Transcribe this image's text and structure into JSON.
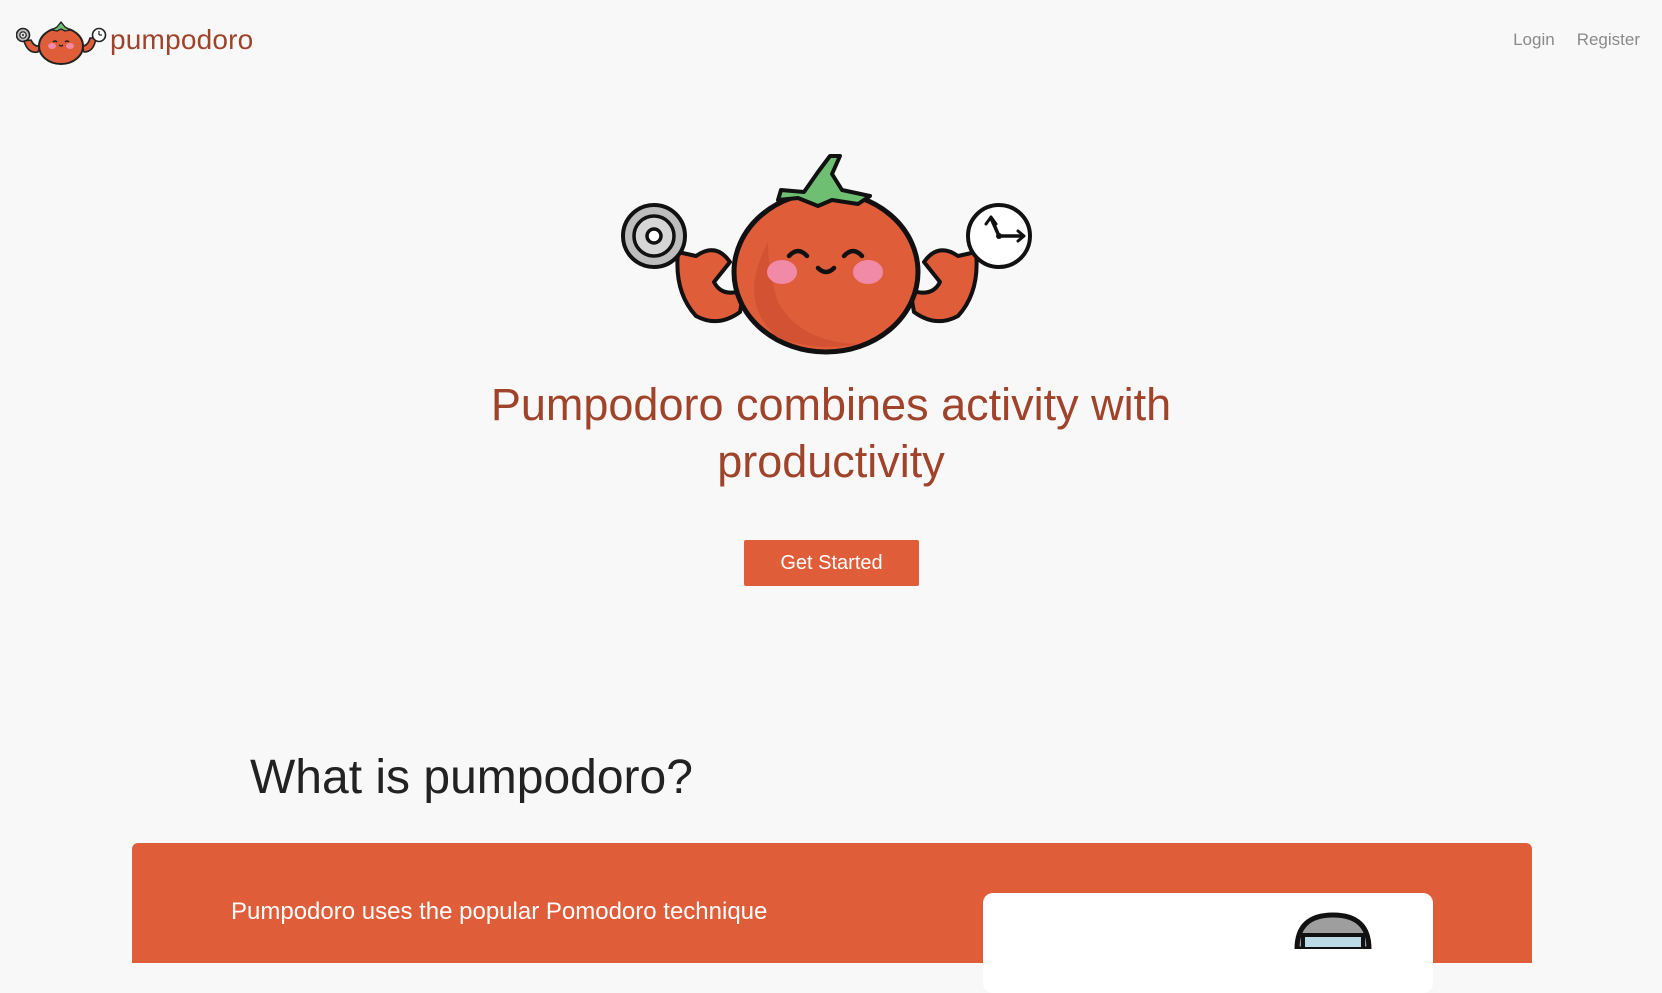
{
  "brand": {
    "name": "pumpodoro"
  },
  "nav": {
    "login_label": "Login",
    "register_label": "Register"
  },
  "hero": {
    "title": "Pumpodoro combines activity with productivity",
    "cta_label": "Get Started"
  },
  "about": {
    "heading": "What is pumpodoro?",
    "description": "Pumpodoro uses the popular Pomodoro technique"
  },
  "colors": {
    "accent": "#e05d3a",
    "brand_text": "#a0432b",
    "background": "#f8f8f8",
    "nav_link": "#8a8a8a"
  },
  "icons": {
    "logo": "tomato-mascot-icon",
    "hero_mascot": "tomato-mascot-icon",
    "dumbbell": "dumbbell-plate-icon",
    "clock": "clock-icon"
  }
}
